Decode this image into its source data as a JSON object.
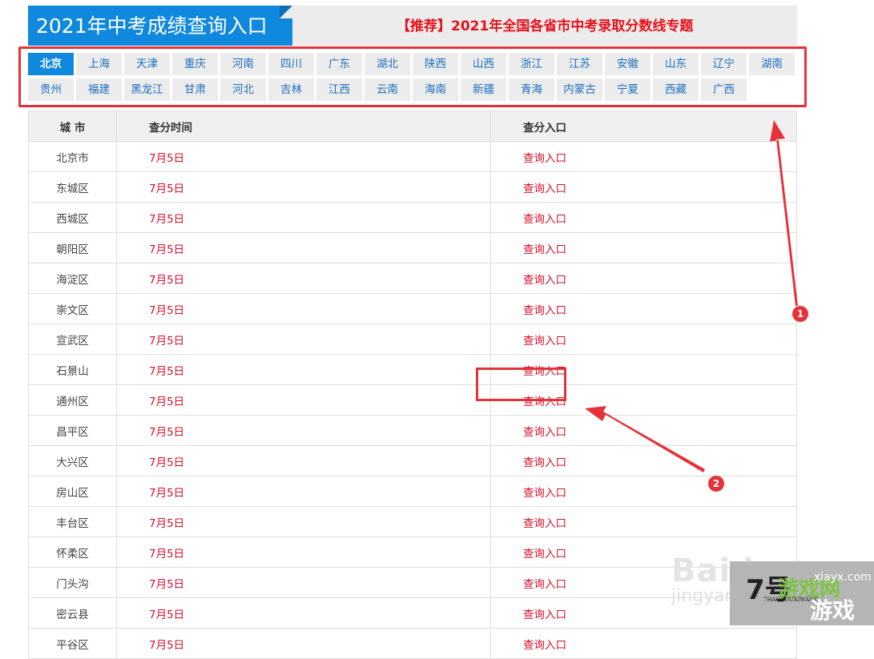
{
  "header": {
    "title": "2021年中考成绩查询入口",
    "promo_link": "【推荐】2021年全国各省市中考录取分数线专题"
  },
  "provinces": {
    "active": "北京",
    "row1": [
      "北京",
      "上海",
      "天津",
      "重庆",
      "河南",
      "四川",
      "广东",
      "湖北",
      "陕西",
      "山西",
      "浙江",
      "江苏",
      "安徽",
      "山东",
      "辽宁",
      "湖南"
    ],
    "row2": [
      "贵州",
      "福建",
      "黑龙江",
      "甘肃",
      "河北",
      "吉林",
      "江西",
      "云南",
      "海南",
      "新疆",
      "青海",
      "内蒙古",
      "宁夏",
      "西藏",
      "广西"
    ]
  },
  "table": {
    "headers": [
      "城 市",
      "查分时间",
      "查分入口"
    ],
    "rows": [
      {
        "city": "北京市",
        "time": "7月5日",
        "entry": "查询入口"
      },
      {
        "city": "东城区",
        "time": "7月5日",
        "entry": "查询入口"
      },
      {
        "city": "西城区",
        "time": "7月5日",
        "entry": "查询入口"
      },
      {
        "city": "朝阳区",
        "time": "7月5日",
        "entry": "查询入口"
      },
      {
        "city": "海淀区",
        "time": "7月5日",
        "entry": "查询入口"
      },
      {
        "city": "崇文区",
        "time": "7月5日",
        "entry": "查询入口"
      },
      {
        "city": "宣武区",
        "time": "7月5日",
        "entry": "查询入口"
      },
      {
        "city": "石景山",
        "time": "7月5日",
        "entry": "查询入口"
      },
      {
        "city": "通州区",
        "time": "7月5日",
        "entry": "查询入口"
      },
      {
        "city": "昌平区",
        "time": "7月5日",
        "entry": "查询入口"
      },
      {
        "city": "大兴区",
        "time": "7月5日",
        "entry": "查询入口"
      },
      {
        "city": "房山区",
        "time": "7月5日",
        "entry": "查询入口"
      },
      {
        "city": "丰台区",
        "time": "7月5日",
        "entry": "查询入口"
      },
      {
        "city": "怀柔区",
        "time": "7月5日",
        "entry": "查询入口"
      },
      {
        "city": "门头沟",
        "time": "7月5日",
        "entry": "查询入口"
      },
      {
        "city": "密云县",
        "time": "7月5日",
        "entry": "查询入口"
      },
      {
        "city": "平谷区",
        "time": "7月5日",
        "entry": "查询入口"
      }
    ]
  },
  "annotations": {
    "badge1": "1",
    "badge2": "2",
    "color": "#e5323a"
  },
  "watermarks": {
    "baidu": "Baidu",
    "jingyan": "jingyan",
    "logo_num": "7号",
    "logo_game": "游戏网",
    "logo_domain": "xiayx.com",
    "logo_youxi": "游戏",
    "logo_sub": "7HAOYOUXIWANG"
  },
  "colors": {
    "brand_blue": "#1088dd",
    "link_red": "#d8102a",
    "promo_red": "#e8101a",
    "province_text": "#1e6fc0"
  }
}
